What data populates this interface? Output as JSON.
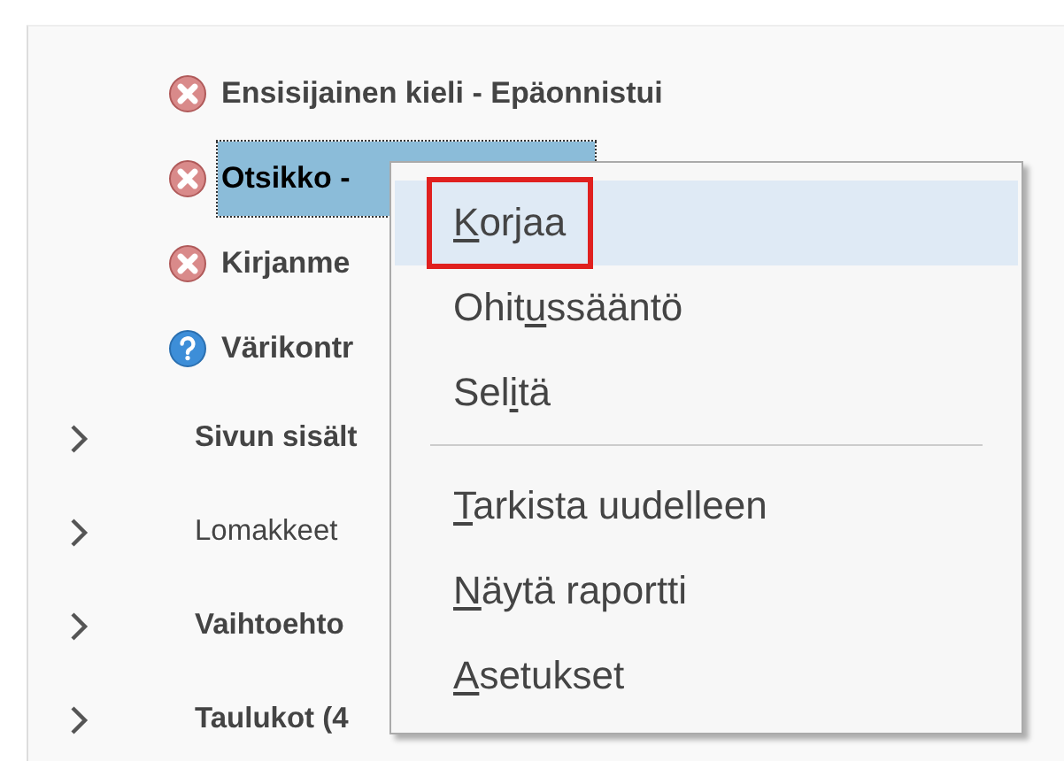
{
  "issues": [
    {
      "kind": "failed",
      "label": "Ensisijainen kieli - Epäonnistui",
      "selected": false
    },
    {
      "kind": "failed",
      "label": "Otsikko -",
      "selected": true
    },
    {
      "kind": "failed",
      "label": "Kirjanme",
      "selected": false
    },
    {
      "kind": "manual",
      "label": "Värikontr",
      "selected": false
    }
  ],
  "categories": [
    {
      "label": "Sivun sisält",
      "bold": true,
      "expanded": false
    },
    {
      "label": "Lomakkeet",
      "bold": false,
      "expanded": false
    },
    {
      "label": "Vaihtoehto",
      "bold": true,
      "expanded": false
    },
    {
      "label": "Taulukot (4",
      "bold": true,
      "expanded": false
    }
  ],
  "context_menu": {
    "items": [
      {
        "kind": "item",
        "highlighted": true,
        "outlined": true,
        "parts": [
          {
            "text": "K",
            "underlined": true
          },
          {
            "text": "orjaa",
            "underlined": false
          }
        ]
      },
      {
        "kind": "item",
        "highlighted": false,
        "outlined": false,
        "parts": [
          {
            "text": "Ohit",
            "underlined": false
          },
          {
            "text": "u",
            "underlined": true
          },
          {
            "text": "ssääntö",
            "underlined": false
          }
        ]
      },
      {
        "kind": "item",
        "highlighted": false,
        "outlined": false,
        "parts": [
          {
            "text": "Sel",
            "underlined": false
          },
          {
            "text": "i",
            "underlined": true
          },
          {
            "text": "tä",
            "underlined": false
          }
        ]
      },
      {
        "kind": "separator"
      },
      {
        "kind": "item",
        "highlighted": false,
        "outlined": false,
        "parts": [
          {
            "text": "T",
            "underlined": true
          },
          {
            "text": "arkista uudelleen",
            "underlined": false
          }
        ]
      },
      {
        "kind": "item",
        "highlighted": false,
        "outlined": false,
        "parts": [
          {
            "text": "N",
            "underlined": true
          },
          {
            "text": "äytä raportti",
            "underlined": false
          }
        ]
      },
      {
        "kind": "item",
        "highlighted": false,
        "outlined": false,
        "parts": [
          {
            "text": "A",
            "underlined": true
          },
          {
            "text": "setukset",
            "underlined": false
          }
        ]
      }
    ]
  }
}
